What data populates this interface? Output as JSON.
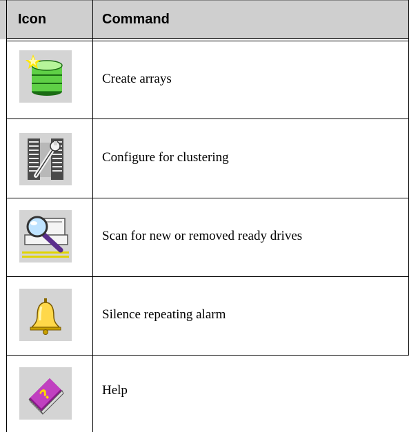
{
  "header": {
    "icon_col": "Icon",
    "command_col": "Command"
  },
  "rows": [
    {
      "icon": "create-arrays-icon",
      "command": "Create arrays"
    },
    {
      "icon": "configure-clustering-icon",
      "command": "Configure for clustering"
    },
    {
      "icon": "scan-drives-icon",
      "command": "Scan for new or removed ready drives"
    },
    {
      "icon": "bell-icon",
      "command": "Silence repeating alarm"
    },
    {
      "icon": "help-book-icon",
      "command": "Help"
    }
  ]
}
